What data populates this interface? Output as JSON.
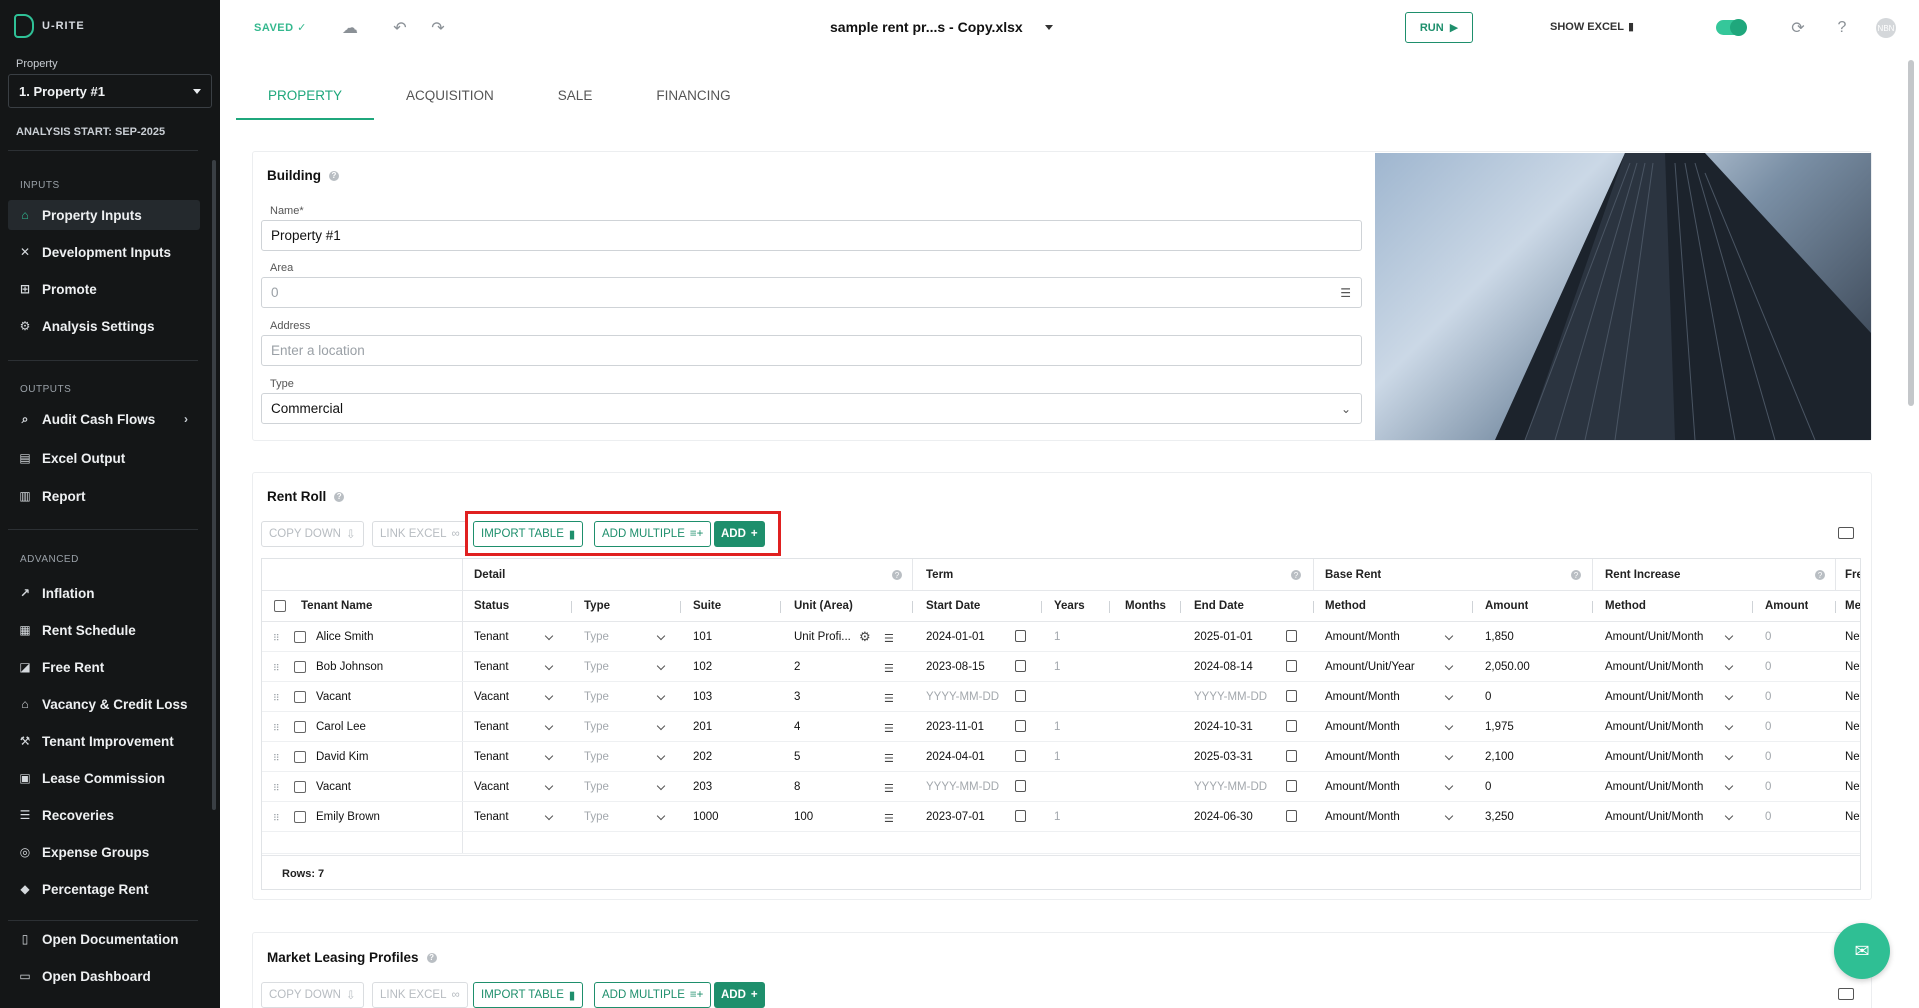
{
  "app": {
    "brand": "U-RITE"
  },
  "sidebar": {
    "property_label": "Property",
    "property_value": "1. Property #1",
    "analysis_start": "ANALYSIS START: SEP-2025",
    "sections": {
      "inputs": "INPUTS",
      "outputs": "OUTPUTS",
      "advanced": "ADVANCED"
    },
    "inputs": [
      {
        "label": "Property Inputs",
        "icon": "home-icon"
      },
      {
        "label": "Development Inputs",
        "icon": "tools-icon"
      },
      {
        "label": "Promote",
        "icon": "tree-icon"
      },
      {
        "label": "Analysis Settings",
        "icon": "gear-icon"
      }
    ],
    "outputs": [
      {
        "label": "Audit Cash Flows",
        "icon": "search-icon"
      },
      {
        "label": "Excel Output",
        "icon": "excel-icon"
      },
      {
        "label": "Report",
        "icon": "report-icon"
      }
    ],
    "advanced": [
      {
        "label": "Inflation",
        "icon": "trend-icon"
      },
      {
        "label": "Rent Schedule",
        "icon": "schedule-icon"
      },
      {
        "label": "Free Rent",
        "icon": "chart-icon"
      },
      {
        "label": "Vacancy & Credit Loss",
        "icon": "bank-icon"
      },
      {
        "label": "Tenant Improvement",
        "icon": "wrench-icon"
      },
      {
        "label": "Lease Commission",
        "icon": "badge-icon"
      },
      {
        "label": "Recoveries",
        "icon": "list-icon"
      },
      {
        "label": "Expense Groups",
        "icon": "group-icon"
      },
      {
        "label": "Percentage Rent",
        "icon": "tag-icon"
      }
    ],
    "bottom": [
      {
        "label": "Open Documentation",
        "icon": "document-icon"
      },
      {
        "label": "Open Dashboard",
        "icon": "monitor-icon"
      }
    ]
  },
  "topbar": {
    "saved": "SAVED",
    "filename": "sample rent pr...s - Copy.xlsx",
    "run": "RUN",
    "show_excel": "SHOW EXCEL",
    "avatar": "NBN"
  },
  "tabs": [
    "PROPERTY",
    "ACQUISITION",
    "SALE",
    "FINANCING"
  ],
  "building": {
    "title": "Building",
    "name_label": "Name*",
    "name_value": "Property #1",
    "area_label": "Area",
    "area_value": "0",
    "address_label": "Address",
    "address_placeholder": "Enter a location",
    "type_label": "Type",
    "type_value": "Commercial"
  },
  "rent_roll": {
    "title": "Rent Roll",
    "buttons": {
      "copy_down": "COPY DOWN",
      "link_excel": "LINK EXCEL",
      "import_table": "IMPORT TABLE",
      "add_multiple": "ADD MULTIPLE",
      "add": "ADD"
    },
    "groups": [
      "Detail",
      "Term",
      "Base Rent",
      "Rent Increase",
      "Fre"
    ],
    "headers": [
      "Tenant Name",
      "Status",
      "Type",
      "Suite",
      "Unit (Area)",
      "Start Date",
      "Years",
      "Months",
      "End Date",
      "Method",
      "Amount",
      "Method",
      "Amount",
      "Me"
    ],
    "type_placeholder": "Type",
    "date_placeholder": "YYYY-MM-DD",
    "rows": [
      {
        "tenant": "Alice Smith",
        "status": "Tenant",
        "suite": "101",
        "unit": "Unit Profi...",
        "start": "2024-01-01",
        "years": "1",
        "end": "2025-01-01",
        "method": "Amount/Month",
        "amount": "1,850",
        "inc_method": "Amount/Unit/Month",
        "inc_amount": "0",
        "fr": "Net"
      },
      {
        "tenant": "Bob Johnson",
        "status": "Tenant",
        "suite": "102",
        "unit": "2",
        "start": "2023-08-15",
        "years": "1",
        "end": "2024-08-14",
        "method": "Amount/Unit/Year",
        "amount": "2,050.00",
        "inc_method": "Amount/Unit/Month",
        "inc_amount": "0",
        "fr": "Net"
      },
      {
        "tenant": "Vacant",
        "status": "Vacant",
        "suite": "103",
        "unit": "3",
        "start": "",
        "years": "",
        "end": "",
        "method": "Amount/Month",
        "amount": "0",
        "inc_method": "Amount/Unit/Month",
        "inc_amount": "0",
        "fr": "Net"
      },
      {
        "tenant": "Carol Lee",
        "status": "Tenant",
        "suite": "201",
        "unit": "4",
        "start": "2023-11-01",
        "years": "1",
        "end": "2024-10-31",
        "method": "Amount/Month",
        "amount": "1,975",
        "inc_method": "Amount/Unit/Month",
        "inc_amount": "0",
        "fr": "Net"
      },
      {
        "tenant": "David Kim",
        "status": "Tenant",
        "suite": "202",
        "unit": "5",
        "start": "2024-04-01",
        "years": "1",
        "end": "2025-03-31",
        "method": "Amount/Month",
        "amount": "2,100",
        "inc_method": "Amount/Unit/Month",
        "inc_amount": "0",
        "fr": "Net"
      },
      {
        "tenant": "Vacant",
        "status": "Vacant",
        "suite": "203",
        "unit": "8",
        "start": "",
        "years": "",
        "end": "",
        "method": "Amount/Month",
        "amount": "0",
        "inc_method": "Amount/Unit/Month",
        "inc_amount": "0",
        "fr": "Net"
      },
      {
        "tenant": "Emily Brown",
        "status": "Tenant",
        "suite": "1000",
        "unit": "100",
        "start": "2023-07-01",
        "years": "1",
        "end": "2024-06-30",
        "method": "Amount/Month",
        "amount": "3,250",
        "inc_method": "Amount/Unit/Month",
        "inc_amount": "0",
        "fr": "Net"
      }
    ],
    "rows_count": "Rows: 7"
  },
  "market": {
    "title": "Market Leasing Profiles",
    "buttons": {
      "copy_down": "COPY DOWN",
      "link_excel": "LINK EXCEL",
      "import_table": "IMPORT TABLE",
      "add_multiple": "ADD MULTIPLE",
      "add": "ADD"
    }
  },
  "colors": {
    "accent": "#1e8f6c",
    "sidebar": "#141617",
    "highlight": "#e02020"
  }
}
